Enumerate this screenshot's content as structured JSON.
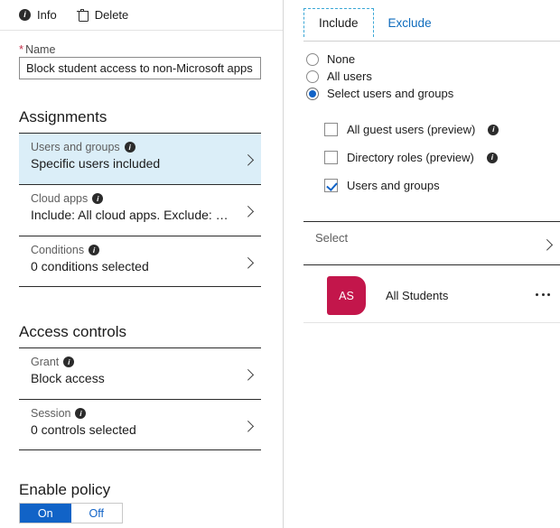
{
  "toolbar": {
    "info_label": "Info",
    "info_icon": "info-circle-icon",
    "delete_label": "Delete",
    "delete_icon": "trash-icon"
  },
  "name_field": {
    "required_marker": "*",
    "label": "Name",
    "value": "Block student access to non-Microsoft apps"
  },
  "assignments": {
    "heading": "Assignments",
    "rows": [
      {
        "title": "Users and groups",
        "subtitle": "Specific users included",
        "selected": true
      },
      {
        "title": "Cloud apps",
        "subtitle": "Include: All cloud apps. Exclude: …",
        "selected": false
      },
      {
        "title": "Conditions",
        "subtitle": "0 conditions selected",
        "selected": false
      }
    ]
  },
  "access_controls": {
    "heading": "Access controls",
    "rows": [
      {
        "title": "Grant",
        "subtitle": "Block access",
        "selected": false
      },
      {
        "title": "Session",
        "subtitle": "0 controls selected",
        "selected": false
      }
    ]
  },
  "enable_policy": {
    "heading": "Enable policy",
    "on_label": "On",
    "off_label": "Off",
    "selected": "On"
  },
  "right_panel": {
    "tabs": [
      {
        "label": "Include",
        "active": true
      },
      {
        "label": "Exclude",
        "active": false
      }
    ],
    "radios": [
      {
        "label": "None",
        "checked": false
      },
      {
        "label": "All users",
        "checked": false
      },
      {
        "label": "Select users and groups",
        "checked": true
      }
    ],
    "checkboxes": [
      {
        "label": "All guest users (preview)",
        "checked": false,
        "info": true
      },
      {
        "label": "Directory roles (preview)",
        "checked": false,
        "info": true
      },
      {
        "label": "Users and groups",
        "checked": true,
        "info": false
      }
    ],
    "select_row": {
      "label": "Select"
    },
    "members": [
      {
        "initials": "AS",
        "name": "All Students",
        "avatar_color": "#C3164B"
      }
    ],
    "overflow_icon": "ellipsis-icon"
  },
  "colors": {
    "accent": "#1163C7",
    "selected_row_bg": "#DBEEF8",
    "required_star": "#C4314B",
    "avatar": "#C3164B",
    "tab_focus": "#3BA7D6"
  }
}
